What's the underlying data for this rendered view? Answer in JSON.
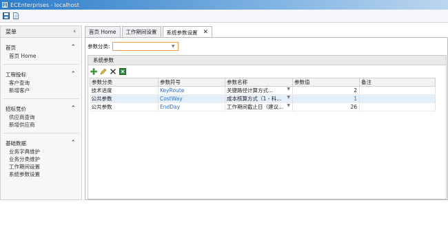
{
  "window": {
    "title": "ECEnterprises - localhost"
  },
  "toolbar": {
    "items": [
      "save-icon",
      "document-icon"
    ]
  },
  "sidebar": {
    "header": "菜单",
    "collapse_glyph": "‹",
    "groups": [
      {
        "title": "首页",
        "items": [
          "首页 Home"
        ]
      },
      {
        "title": "工程投标",
        "items": [
          "客户查询",
          "新增客户"
        ]
      },
      {
        "title": "招标竞价",
        "items": [
          "供应商查询",
          "新增供应商"
        ]
      },
      {
        "title": "基础数据",
        "items": [
          "业务字典维护",
          "业务分类维护",
          "工作期间设置",
          "系统参数设置"
        ]
      }
    ]
  },
  "tabs": [
    {
      "label": "首页 Home",
      "active": false
    },
    {
      "label": "工作期间设置",
      "active": false
    },
    {
      "label": "系统参数设置",
      "active": true,
      "close": "✕"
    }
  ],
  "filter": {
    "label": "参数分类:",
    "value": ""
  },
  "panel": {
    "title": "系统参数",
    "columns": [
      "参数分类",
      "参数符号",
      "参数名称",
      "参数值",
      "备注"
    ],
    "rows": [
      {
        "category": "技术进度",
        "symbol": "KeyRoute",
        "name": "关键路径计算方式...",
        "value": "2",
        "note": ""
      },
      {
        "category": "公共参数",
        "symbol": "CostWay",
        "name": "成本核算方式（1 - 科...",
        "value": "1",
        "note": ""
      },
      {
        "category": "公共参数",
        "symbol": "EndDay",
        "name": "工作期间截止日（建议...",
        "value": "26",
        "note": ""
      }
    ]
  },
  "colors": {
    "title_bar": "#2d7ccb",
    "link": "#2a6fc2",
    "combo_border": "#f0a050",
    "selected_row": "#e4eef9"
  }
}
